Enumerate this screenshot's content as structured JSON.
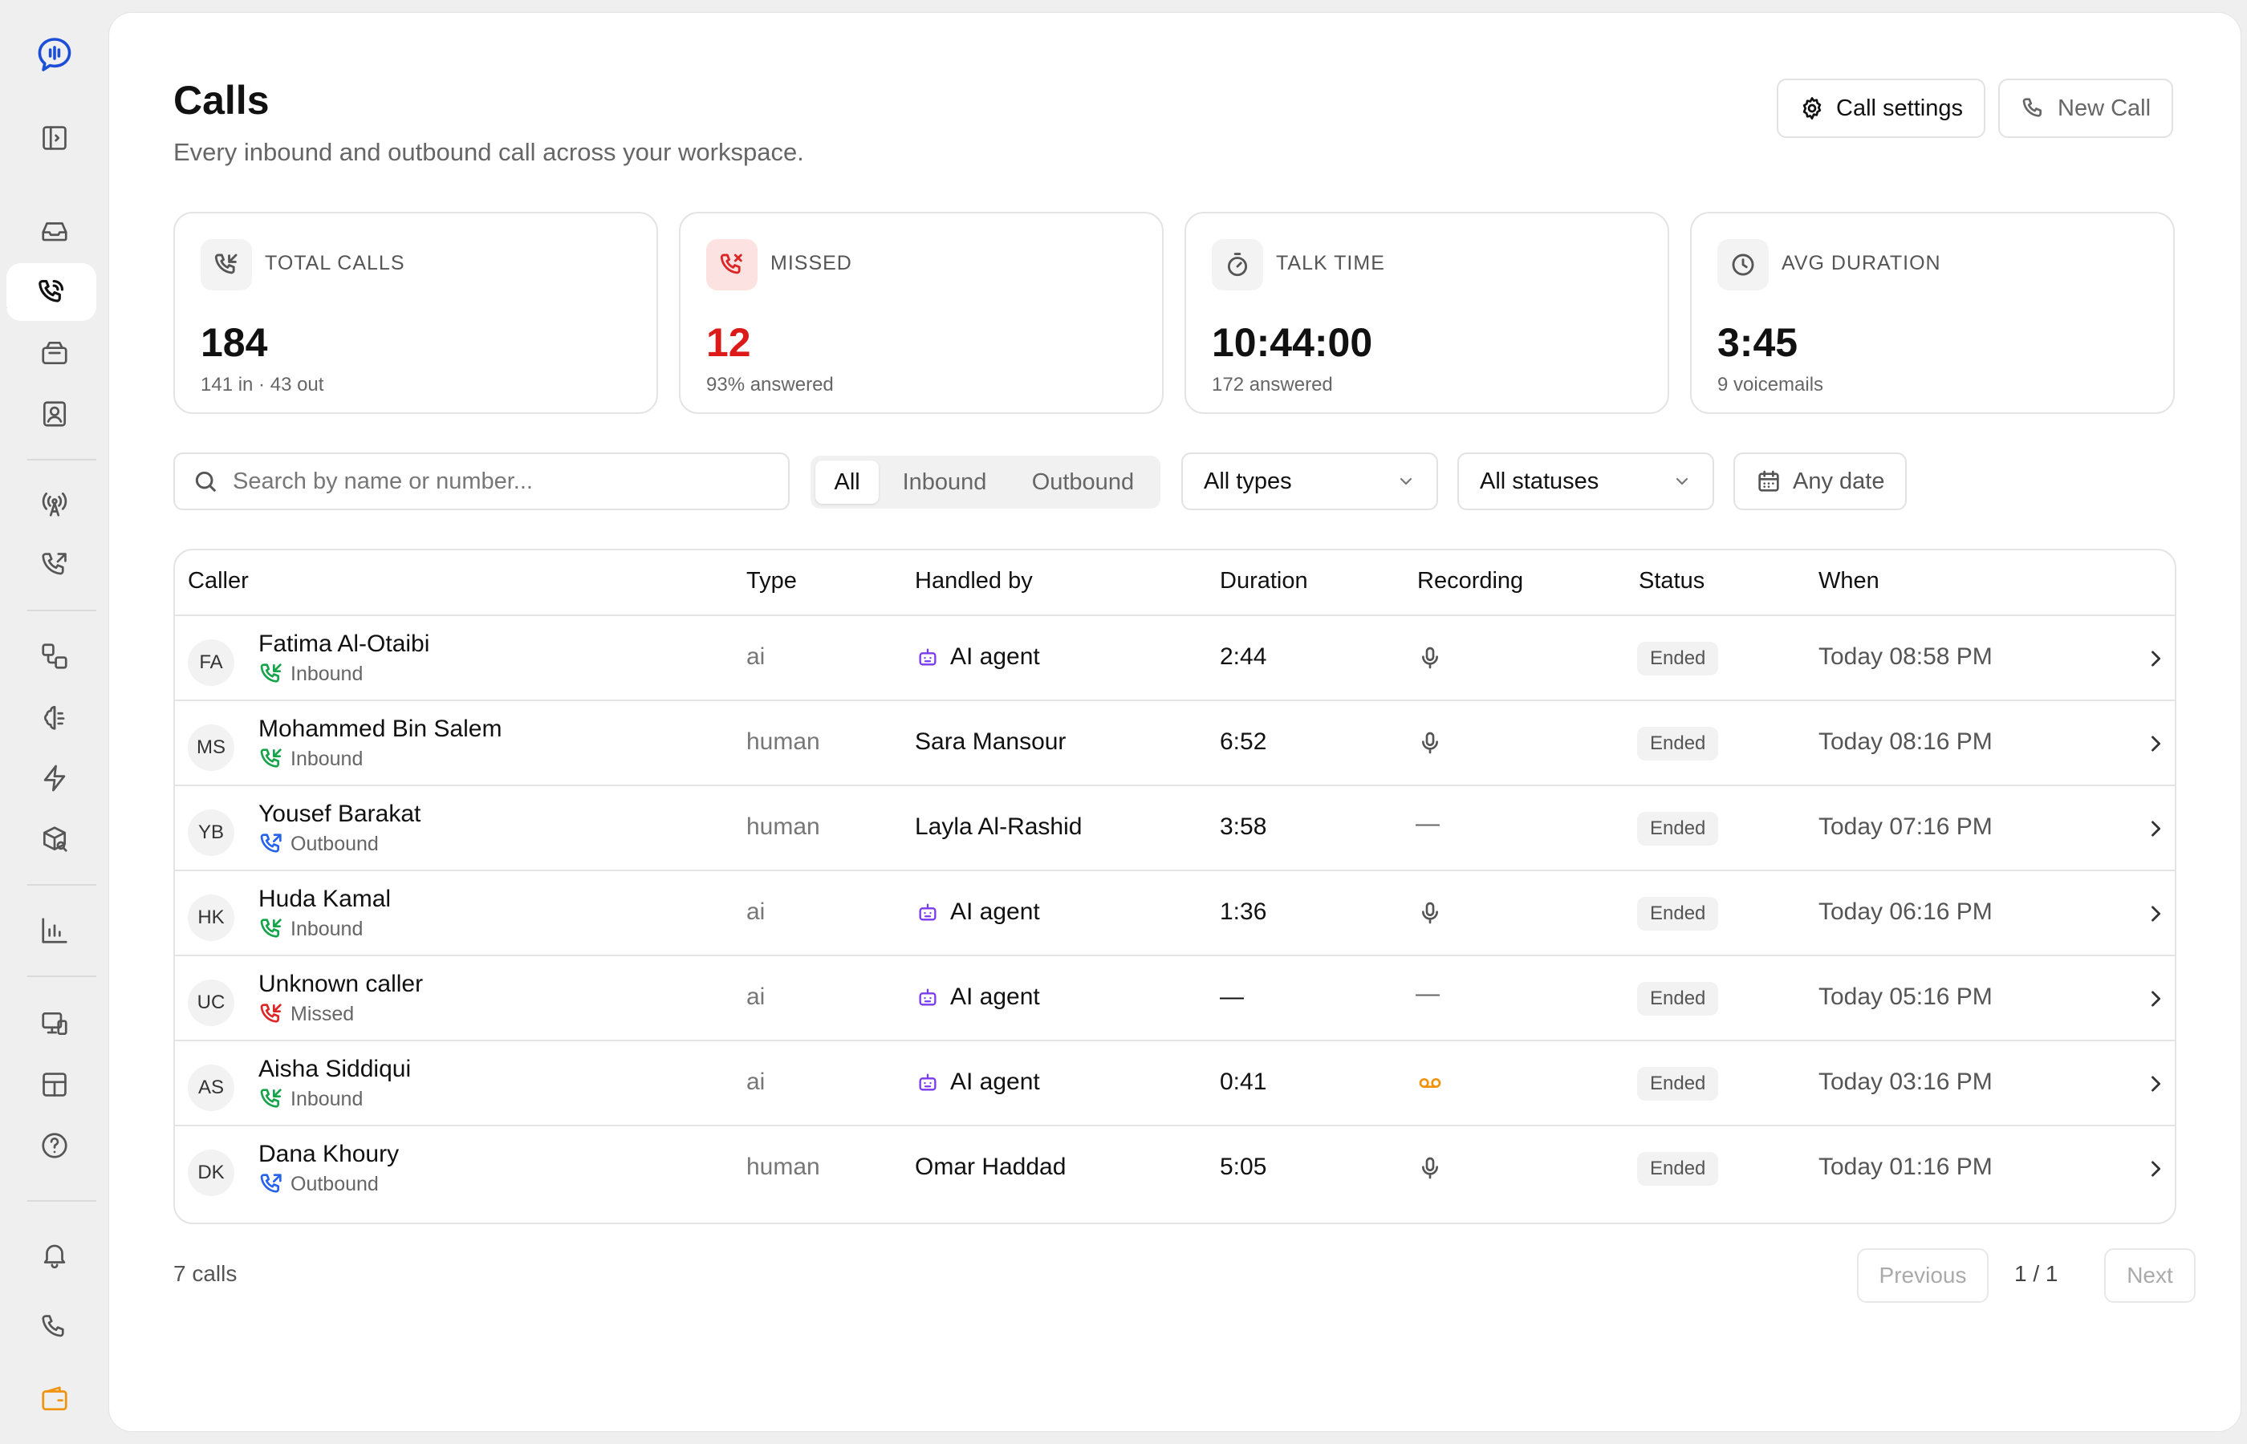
{
  "header": {
    "title": "Calls",
    "subtitle": "Every inbound and outbound call across your workspace.",
    "call_settings_label": "Call settings",
    "new_call_label": "New Call"
  },
  "stats": [
    {
      "label": "TOTAL CALLS",
      "value": "184",
      "sub": "141 in · 43 out",
      "icon": "phone-incoming-icon"
    },
    {
      "label": "MISSED",
      "value": "12",
      "sub": "93% answered",
      "icon": "phone-missed-icon",
      "accent": "#dc2626"
    },
    {
      "label": "TALK TIME",
      "value": "10:44:00",
      "sub": "172 answered",
      "icon": "timer-icon"
    },
    {
      "label": "AVG DURATION",
      "value": "3:45",
      "sub": "9 voicemails",
      "icon": "clock-icon"
    }
  ],
  "filters": {
    "search_placeholder": "Search by name or number...",
    "segments": [
      "All",
      "Inbound",
      "Outbound"
    ],
    "active_segment": "All",
    "type_value": "All types",
    "status_value": "All statuses",
    "date_value": "Any date"
  },
  "table": {
    "columns": [
      "Caller",
      "Type",
      "Handled by",
      "Duration",
      "Recording",
      "Status",
      "When"
    ],
    "rows": [
      {
        "initials": "FA",
        "name": "Fatima Al-Otaibi",
        "direction": "Inbound",
        "type": "ai",
        "handled_by": "AI agent",
        "duration": "2:44",
        "recording": "mic",
        "status": "Ended",
        "when": "Today 08:58 PM"
      },
      {
        "initials": "MS",
        "name": "Mohammed Bin Salem",
        "direction": "Inbound",
        "type": "human",
        "handled_by": "Sara Mansour",
        "duration": "6:52",
        "recording": "mic",
        "status": "Ended",
        "when": "Today 08:16 PM"
      },
      {
        "initials": "YB",
        "name": "Yousef Barakat",
        "direction": "Outbound",
        "type": "human",
        "handled_by": "Layla Al-Rashid",
        "duration": "3:58",
        "recording": "none",
        "status": "Ended",
        "when": "Today 07:16 PM"
      },
      {
        "initials": "HK",
        "name": "Huda Kamal",
        "direction": "Inbound",
        "type": "ai",
        "handled_by": "AI agent",
        "duration": "1:36",
        "recording": "mic",
        "status": "Ended",
        "when": "Today 06:16 PM"
      },
      {
        "initials": "UC",
        "name": "Unknown caller",
        "direction": "Missed",
        "type": "ai",
        "handled_by": "AI agent",
        "duration": "—",
        "recording": "none",
        "status": "Ended",
        "when": "Today 05:16 PM"
      },
      {
        "initials": "AS",
        "name": "Aisha Siddiqui",
        "direction": "Inbound",
        "type": "ai",
        "handled_by": "AI agent",
        "duration": "0:41",
        "recording": "voicemail",
        "status": "Ended",
        "when": "Today 03:16 PM"
      },
      {
        "initials": "DK",
        "name": "Dana Khoury",
        "direction": "Outbound",
        "type": "human",
        "handled_by": "Omar Haddad",
        "duration": "5:05",
        "recording": "mic",
        "status": "Ended",
        "when": "Today 01:16 PM"
      }
    ],
    "empty_symbol": "—"
  },
  "footer": {
    "count": "7 calls",
    "previous_label": "Previous",
    "page_indicator": "1 / 1",
    "next_label": "Next"
  },
  "colors": {
    "inbound": "#16a34a",
    "outbound": "#2563eb",
    "missed": "#dc2626",
    "ai_agent": "#7c3aed",
    "voicemail": "#f0930a",
    "brand": "#1d4ed8",
    "wallet": "#f0930a"
  },
  "sidebar": {
    "icons": [
      "logo-icon",
      "toggle-sidebar-icon",
      "inbox-icon",
      "calls-icon",
      "campaigns-icon",
      "contacts-icon",
      "broadcast-icon",
      "outbound-call-icon",
      "flows-icon",
      "ai-brain-icon",
      "automations-icon",
      "knowledge-icon",
      "analytics-icon",
      "devices-icon",
      "layout-icon",
      "help-icon",
      "notifications-icon",
      "phone-icon",
      "wallet-icon"
    ],
    "active": "calls-icon"
  }
}
